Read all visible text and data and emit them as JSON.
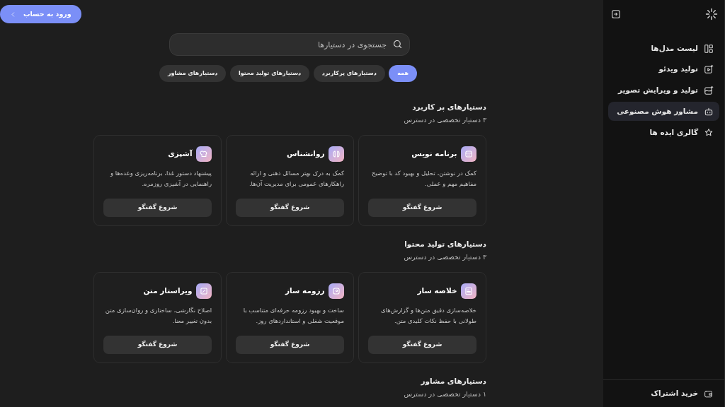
{
  "sidebar": {
    "items": [
      {
        "label": "لیست مدل‌ها",
        "selected": false
      },
      {
        "label": "تولید ویدئو",
        "selected": false
      },
      {
        "label": "تولید و ویرایش تصویر",
        "selected": false
      },
      {
        "label": "مشاور هوش مصنوعی",
        "selected": true
      },
      {
        "label": "گالری ایده ها",
        "selected": false
      }
    ],
    "footer_item": {
      "label": "خرید اشتراک"
    }
  },
  "login_button": {
    "label": "ورود به حساب"
  },
  "search": {
    "placeholder": "جستجوی در دستیارها"
  },
  "filters": [
    {
      "label": "همه",
      "selected": true
    },
    {
      "label": "دستیارهای پرکاربرد",
      "selected": false
    },
    {
      "label": "دستیارهای تولید محتوا",
      "selected": false
    },
    {
      "label": "دستیارهای مشاور",
      "selected": false
    }
  ],
  "sections": [
    {
      "title": "دستیارهای پر کاربرد",
      "count": "۳ دستیار تخصصی در دسترس",
      "cards": [
        {
          "title": "برنامه نویس",
          "description": "کمک در نوشتن، تحلیل و بهبود کد با توضیح مفاهیم مهم و عملی.",
          "button": "شروع گفتگو"
        },
        {
          "title": "روانشناس",
          "description": "کمک به درک بهتر مسائل ذهنی و ارائه راهکارهای عمومی برای مدیریت آن‌ها.",
          "button": "شروع گفتگو"
        },
        {
          "title": "آشپزی",
          "description": "پیشنهاد دستور غذا، برنامه‌ریزی وعده‌ها و راهنمایی در آشپزی روزمره.",
          "button": "شروع گفتگو"
        }
      ]
    },
    {
      "title": "دستیارهای تولید محتوا",
      "count": "۳ دستیار تخصصی در دسترس",
      "cards": [
        {
          "title": "خلاصه ساز",
          "description": "خلاصه‌سازی دقیق متن‌ها و گزارش‌های طولانی با حفظ نکات کلیدی متن.",
          "button": "شروع گفتگو"
        },
        {
          "title": "رزومه ساز",
          "description": "ساخت و بهبود رزومه حرفه‌ای متناسب با موقعیت شغلی و استانداردهای روز.",
          "button": "شروع گفتگو"
        },
        {
          "title": "ویراستار متن",
          "description": "اصلاح نگارشی، ساختاری و روان‌سازی متن بدون تغییر معنا.",
          "button": "شروع گفتگو"
        }
      ]
    },
    {
      "title": "دستیارهای مشاور",
      "count": "۱ دستیار تخصصی در دسترس"
    }
  ]
}
